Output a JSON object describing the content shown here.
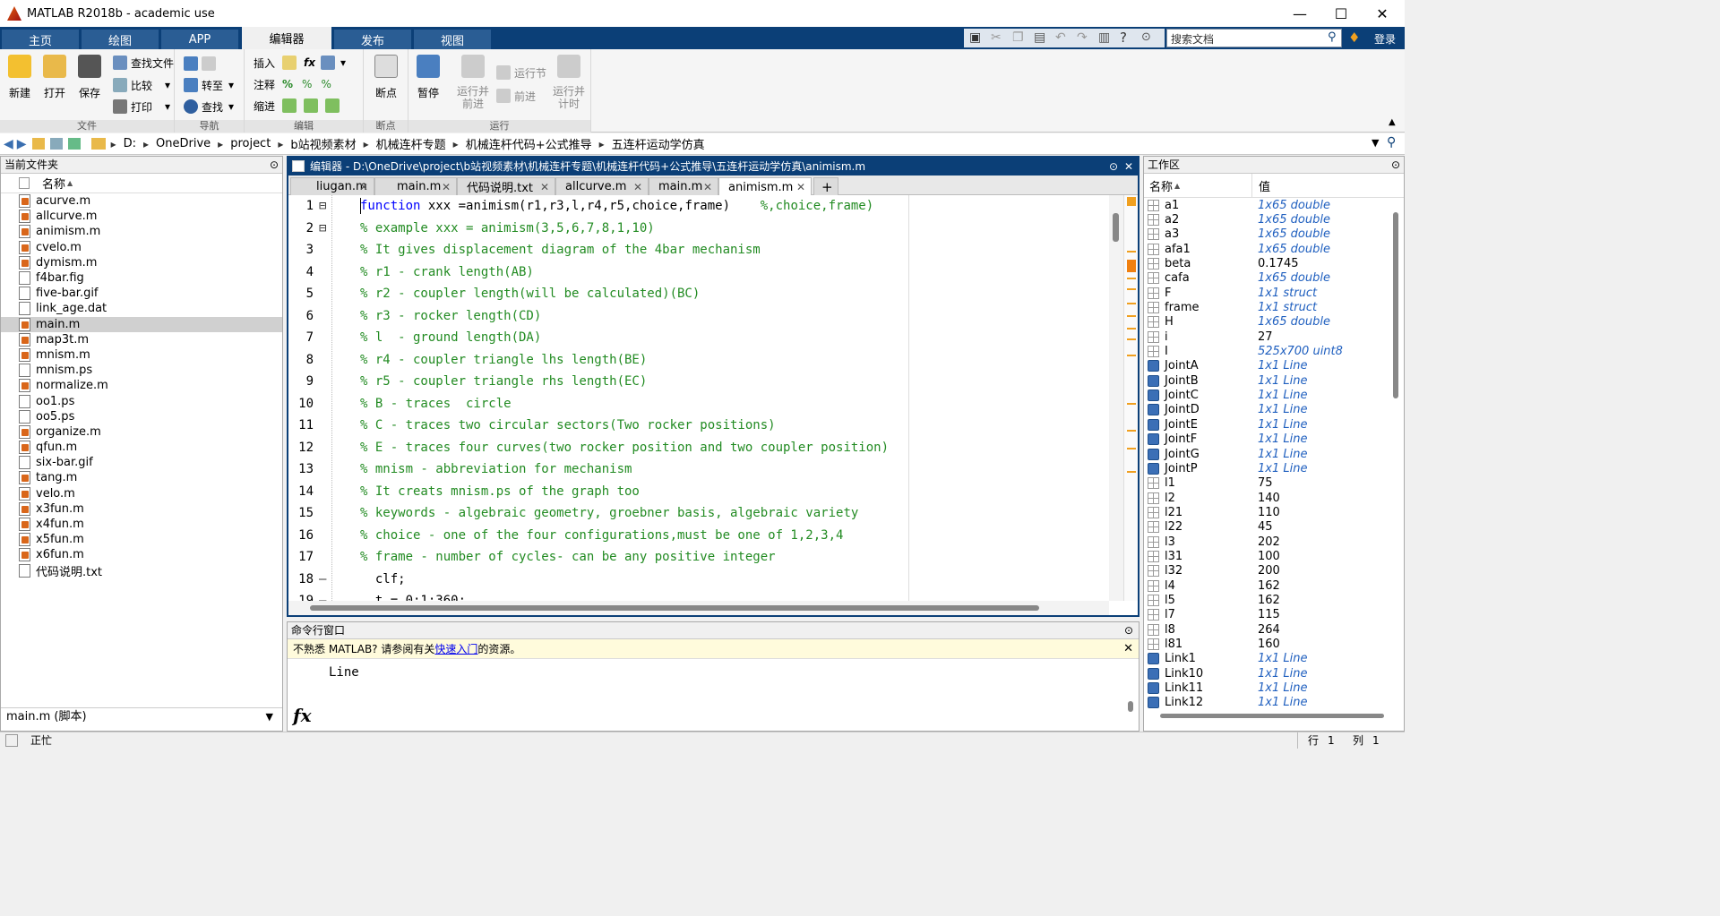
{
  "app": {
    "title": "MATLAB R2018b - academic use"
  },
  "ribbon_tabs": [
    "主页",
    "绘图",
    "APP",
    "编辑器",
    "发布",
    "视图"
  ],
  "active_tab": "编辑器",
  "search": {
    "placeholder": "搜索文档"
  },
  "login_label": "登录",
  "ribbon": {
    "file": {
      "label": "文件",
      "new": "新建",
      "open": "打开",
      "save": "保存",
      "find_files": "查找文件",
      "compare": "比较",
      "print": "打印"
    },
    "nav": {
      "label": "导航",
      "goto": "转至",
      "find": "查找"
    },
    "edit": {
      "label": "编辑",
      "insert": "插入",
      "comment": "注释",
      "indent": "缩进",
      "fx": "fx"
    },
    "breakpoints": {
      "label": "断点",
      "btn": "断点"
    },
    "run": {
      "label": "运行",
      "pause": "暂停",
      "run_advance": "运行并\n前进",
      "run_section": "运行节",
      "advance": "前进",
      "run_time": "运行并\n计时"
    }
  },
  "address": {
    "drive": "D:",
    "crumbs": [
      "OneDrive",
      "project",
      "b站视频素材",
      "机械连杆专题",
      "机械连杆代码+公式推导",
      "五连杆运动学仿真"
    ]
  },
  "current_folder": {
    "title": "当前文件夹",
    "col_name": "名称",
    "sort": "▲",
    "files": [
      {
        "name": "acurve.m",
        "type": "m"
      },
      {
        "name": "allcurve.m",
        "type": "m"
      },
      {
        "name": "animism.m",
        "type": "m"
      },
      {
        "name": "cvelo.m",
        "type": "m"
      },
      {
        "name": "dymism.m",
        "type": "m"
      },
      {
        "name": "f4bar.fig",
        "type": "fig"
      },
      {
        "name": "five-bar.gif",
        "type": "gif"
      },
      {
        "name": "link_age.dat",
        "type": "dat"
      },
      {
        "name": "main.m",
        "type": "m",
        "selected": true
      },
      {
        "name": "map3t.m",
        "type": "m"
      },
      {
        "name": "mnism.m",
        "type": "m"
      },
      {
        "name": "mnism.ps",
        "type": "ps"
      },
      {
        "name": "normalize.m",
        "type": "m"
      },
      {
        "name": "oo1.ps",
        "type": "ps"
      },
      {
        "name": "oo5.ps",
        "type": "ps"
      },
      {
        "name": "organize.m",
        "type": "m"
      },
      {
        "name": "qfun.m",
        "type": "m"
      },
      {
        "name": "six-bar.gif",
        "type": "gif"
      },
      {
        "name": "tang.m",
        "type": "m"
      },
      {
        "name": "velo.m",
        "type": "m"
      },
      {
        "name": "x3fun.m",
        "type": "m"
      },
      {
        "name": "x4fun.m",
        "type": "m"
      },
      {
        "name": "x5fun.m",
        "type": "m"
      },
      {
        "name": "x6fun.m",
        "type": "m"
      },
      {
        "name": "代码说明.txt",
        "type": "txt"
      }
    ],
    "details": "main.m  (脚本)"
  },
  "editor": {
    "title": "编辑器 - D:\\OneDrive\\project\\b站视频素材\\机械连杆专题\\机械连杆代码+公式推导\\五连杆运动学仿真\\animism.m",
    "tabs": [
      "liugan.m",
      "main.m",
      "代码说明.txt",
      "allcurve.m",
      "main.m",
      "animism.m"
    ],
    "active_tab_index": 5,
    "add_tab": "+",
    "lines": [
      {
        "n": "1",
        "mark": "⊟",
        "kw": "function",
        "code": " xxx =animism(r1,r3,l,r4,r5,choice,frame)",
        "cmt": "    %,choice,frame)"
      },
      {
        "n": "2",
        "mark": "⊟",
        "kw": "",
        "code": "",
        "cmt": "% example xxx = animism(3,5,6,7,8,1,10)"
      },
      {
        "n": "3",
        "mark": "",
        "kw": "",
        "code": "",
        "cmt": "% It gives displacement diagram of the 4bar mechanism"
      },
      {
        "n": "4",
        "mark": "",
        "kw": "",
        "code": "",
        "cmt": "% r1 - crank length(AB)"
      },
      {
        "n": "5",
        "mark": "",
        "kw": "",
        "code": "",
        "cmt": "% r2 - coupler length(will be calculated)(BC)"
      },
      {
        "n": "6",
        "mark": "",
        "kw": "",
        "code": "",
        "cmt": "% r3 - rocker length(CD)"
      },
      {
        "n": "7",
        "mark": "",
        "kw": "",
        "code": "",
        "cmt": "% l  - ground length(DA)"
      },
      {
        "n": "8",
        "mark": "",
        "kw": "",
        "code": "",
        "cmt": "% r4 - coupler triangle lhs length(BE)"
      },
      {
        "n": "9",
        "mark": "",
        "kw": "",
        "code": "",
        "cmt": "% r5 - coupler triangle rhs length(EC)"
      },
      {
        "n": "10",
        "mark": "",
        "kw": "",
        "code": "",
        "cmt": "% B - traces  circle"
      },
      {
        "n": "11",
        "mark": "",
        "kw": "",
        "code": "",
        "cmt": "% C - traces two circular sectors(Two rocker positions)"
      },
      {
        "n": "12",
        "mark": "",
        "kw": "",
        "code": "",
        "cmt": "% E - traces four curves(two rocker position and two coupler position)"
      },
      {
        "n": "13",
        "mark": "",
        "kw": "",
        "code": "",
        "cmt": "% mnism - abbreviation for mechanism"
      },
      {
        "n": "14",
        "mark": "",
        "kw": "",
        "code": "",
        "cmt": "% It creats mnism.ps of the graph too"
      },
      {
        "n": "15",
        "mark": "",
        "kw": "",
        "code": "",
        "cmt": "% keywords - algebraic geometry, groebner basis, algebraic variety"
      },
      {
        "n": "16",
        "mark": "",
        "kw": "",
        "code": "",
        "cmt": "% choice - one of the four configurations,must be one of 1,2,3,4"
      },
      {
        "n": "17",
        "mark": "",
        "kw": "",
        "code": "",
        "cmt": "% frame - number of cycles- can be any positive integer"
      },
      {
        "n": "18",
        "mark": "—",
        "kw": "",
        "code": "  clf;",
        "cmt": ""
      },
      {
        "n": "19",
        "mark": "—",
        "kw": "",
        "code": "  t = 0:1:360;",
        "cmt": ""
      }
    ]
  },
  "command_window": {
    "title": "命令行窗口",
    "info_prefix": "不熟悉 MATLAB? 请参阅有关",
    "info_link": "快速入门",
    "info_suffix": "的资源。",
    "output": "Line",
    "fx": "fx"
  },
  "workspace": {
    "title": "工作区",
    "col_name": "名称",
    "sort": "▲",
    "col_value": "值",
    "vars": [
      {
        "name": "a1",
        "value": "1x65 double",
        "style": "it",
        "icon": "grid"
      },
      {
        "name": "a2",
        "value": "1x65 double",
        "style": "it",
        "icon": "grid"
      },
      {
        "name": "a3",
        "value": "1x65 double",
        "style": "it",
        "icon": "grid"
      },
      {
        "name": "afa1",
        "value": "1x65 double",
        "style": "it",
        "icon": "grid"
      },
      {
        "name": "beta",
        "value": "0.1745",
        "style": "",
        "icon": "grid"
      },
      {
        "name": "cafa",
        "value": "1x65 double",
        "style": "it",
        "icon": "grid"
      },
      {
        "name": "F",
        "value": "1x1 struct",
        "style": "it",
        "icon": "grid"
      },
      {
        "name": "frame",
        "value": "1x1 struct",
        "style": "it",
        "icon": "grid"
      },
      {
        "name": "H",
        "value": "1x65 double",
        "style": "it",
        "icon": "grid"
      },
      {
        "name": "i",
        "value": "27",
        "style": "",
        "icon": "grid"
      },
      {
        "name": "I",
        "value": "525x700 uint8",
        "style": "it",
        "icon": "grid"
      },
      {
        "name": "JointA",
        "value": "1x1 Line",
        "style": "it",
        "icon": "obj"
      },
      {
        "name": "JointB",
        "value": "1x1 Line",
        "style": "it",
        "icon": "obj"
      },
      {
        "name": "JointC",
        "value": "1x1 Line",
        "style": "it",
        "icon": "obj"
      },
      {
        "name": "JointD",
        "value": "1x1 Line",
        "style": "it",
        "icon": "obj"
      },
      {
        "name": "JointE",
        "value": "1x1 Line",
        "style": "it",
        "icon": "obj"
      },
      {
        "name": "JointF",
        "value": "1x1 Line",
        "style": "it",
        "icon": "obj"
      },
      {
        "name": "JointG",
        "value": "1x1 Line",
        "style": "it",
        "icon": "obj"
      },
      {
        "name": "JointP",
        "value": "1x1 Line",
        "style": "it",
        "icon": "obj"
      },
      {
        "name": "l1",
        "value": "75",
        "style": "",
        "icon": "grid"
      },
      {
        "name": "l2",
        "value": "140",
        "style": "",
        "icon": "grid"
      },
      {
        "name": "l21",
        "value": "110",
        "style": "",
        "icon": "grid"
      },
      {
        "name": "l22",
        "value": "45",
        "style": "",
        "icon": "grid"
      },
      {
        "name": "l3",
        "value": "202",
        "style": "",
        "icon": "grid"
      },
      {
        "name": "l31",
        "value": "100",
        "style": "",
        "icon": "grid"
      },
      {
        "name": "l32",
        "value": "200",
        "style": "",
        "icon": "grid"
      },
      {
        "name": "l4",
        "value": "162",
        "style": "",
        "icon": "grid"
      },
      {
        "name": "l5",
        "value": "162",
        "style": "",
        "icon": "grid"
      },
      {
        "name": "l7",
        "value": "115",
        "style": "",
        "icon": "grid"
      },
      {
        "name": "l8",
        "value": "264",
        "style": "",
        "icon": "grid"
      },
      {
        "name": "l81",
        "value": "160",
        "style": "",
        "icon": "grid"
      },
      {
        "name": "Link1",
        "value": "1x1 Line",
        "style": "it",
        "icon": "obj"
      },
      {
        "name": "Link10",
        "value": "1x1 Line",
        "style": "it",
        "icon": "obj"
      },
      {
        "name": "Link11",
        "value": "1x1 Line",
        "style": "it",
        "icon": "obj"
      },
      {
        "name": "Link12",
        "value": "1x1 Line",
        "style": "it",
        "icon": "obj"
      }
    ]
  },
  "statusbar": {
    "state": "正忙",
    "row_label": "行",
    "row": "1",
    "col_label": "列",
    "col": "1"
  }
}
